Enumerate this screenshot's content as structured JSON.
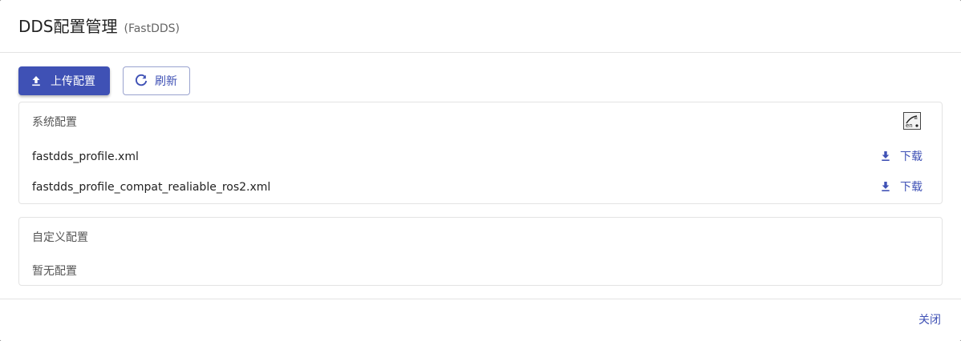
{
  "dialog": {
    "title": "DDS配置管理",
    "subtitle": "(FastDDS)"
  },
  "toolbar": {
    "upload_label": "上传配置",
    "refresh_label": "刷新"
  },
  "system_config": {
    "title": "系统配置",
    "ime_indicator": "en",
    "files": [
      {
        "name": "fastdds_profile.xml",
        "action": "下载"
      },
      {
        "name": "fastdds_profile_compat_realiable_ros2.xml",
        "action": "下载"
      }
    ]
  },
  "custom_config": {
    "title": "自定义配置",
    "empty_text": "暂无配置"
  },
  "footer": {
    "close_label": "关闭"
  },
  "colors": {
    "primary": "#3f51b5",
    "border": "#e3e3e3"
  },
  "icons": {
    "upload": "upload-icon",
    "refresh": "refresh-icon",
    "download": "download-icon",
    "ime": "ime-switch-icon"
  }
}
